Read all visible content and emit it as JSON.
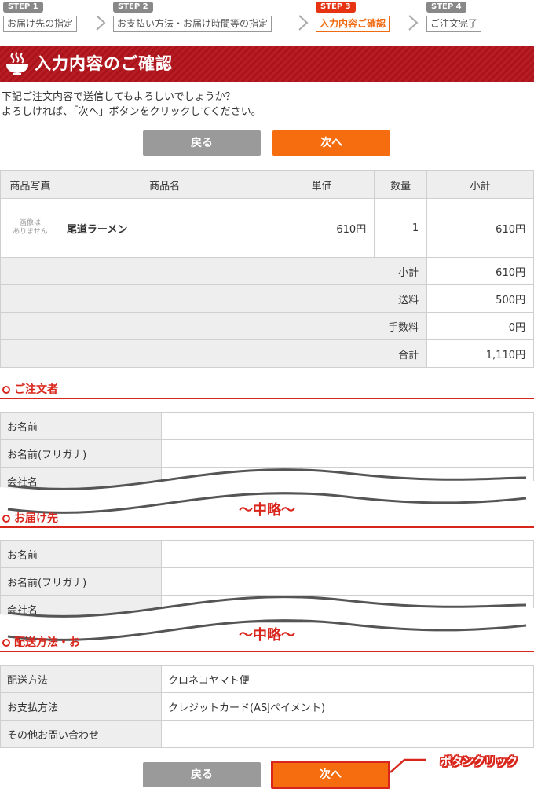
{
  "steps": [
    {
      "badge": "STEP 1",
      "label": "お届け先の指定"
    },
    {
      "badge": "STEP 2",
      "label": "お支払い方法・お届け時間等の指定"
    },
    {
      "badge": "STEP 3",
      "label": "入力内容ご確認"
    },
    {
      "badge": "STEP 4",
      "label": "ご注文完了"
    }
  ],
  "page_title": "入力内容のご確認",
  "intro": {
    "line1": "下記ご注文内容で送信してもよろしいでしょうか？",
    "line2": "よろしければ、「次へ」ボタンをクリックしてください。"
  },
  "buttons": {
    "back": "戻る",
    "next": "次へ"
  },
  "cart": {
    "headers": [
      "商品写真",
      "商品名",
      "単価",
      "数量",
      "小計"
    ],
    "item": {
      "no_image_1": "画像は",
      "no_image_2": "ありません",
      "name": "尾道ラーメン",
      "price": "610円",
      "qty": "1",
      "subtotal": "610円"
    },
    "summary": [
      {
        "label": "小計",
        "value": "610円"
      },
      {
        "label": "送料",
        "value": "500円"
      },
      {
        "label": "手数料",
        "value": "0円"
      },
      {
        "label": "合計",
        "value": "1,110円"
      }
    ]
  },
  "orderer": {
    "title": "ご注文者",
    "rows": [
      "お名前",
      "お名前(フリガナ)",
      "会社名"
    ]
  },
  "delivery": {
    "title": "お届け先",
    "rows": [
      "お名前",
      "お名前(フリガナ)",
      "会社名"
    ]
  },
  "shipping": {
    "title": "配送方法・お",
    "rows": [
      {
        "label": "配送方法",
        "value": "クロネコヤマト便"
      },
      {
        "label": "お支払方法",
        "value": "クレジットカード(ASJペイメント)"
      },
      {
        "label": "その他お問い合わせ",
        "value": ""
      }
    ]
  },
  "omitted": "～中略～",
  "callout": "ボタンクリック",
  "colors": {
    "accent": "#d9261c",
    "button_orange": "#f56d0f",
    "button_gray": "#9a9a9a",
    "title_bg": "#b3141b"
  }
}
